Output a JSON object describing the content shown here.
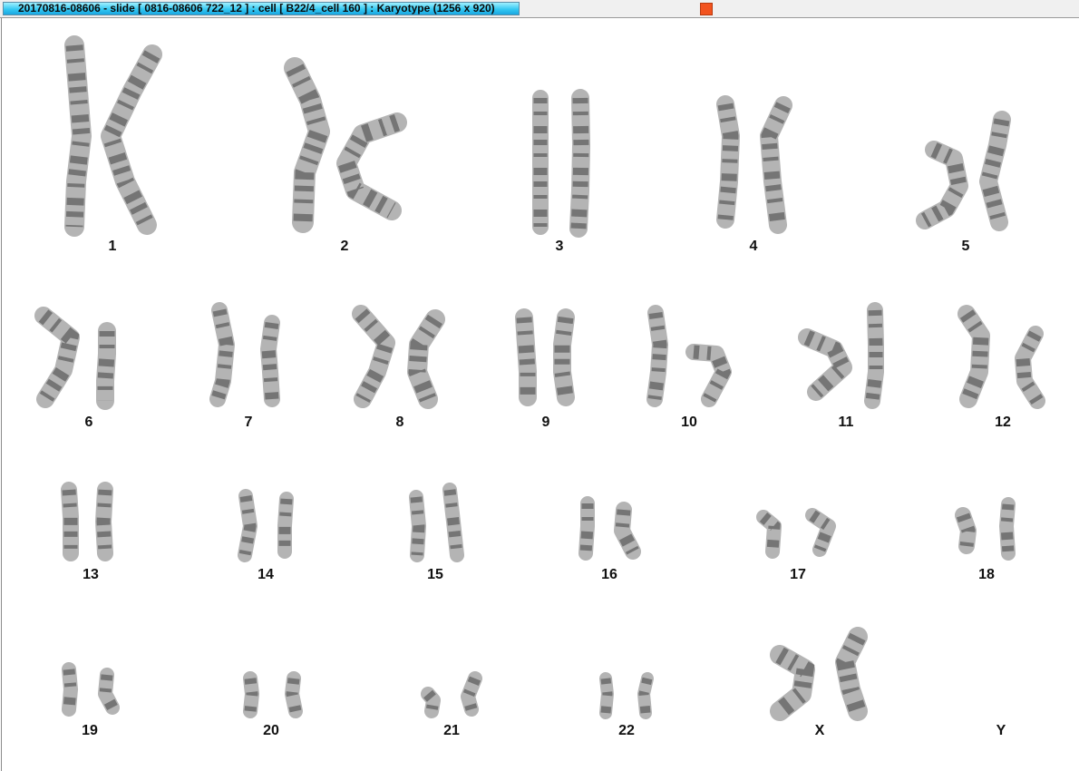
{
  "window": {
    "title": "20170816-08606 - slide [ 0816-08606 722_12 ] : cell [ B22/4_cell 160 ] : Karyotype  (1256 x 920)",
    "close_color": "#f2531f",
    "title_color": "#35c9f2"
  },
  "karyotype": {
    "labels": [
      "1",
      "2",
      "3",
      "4",
      "5",
      "6",
      "7",
      "8",
      "9",
      "10",
      "11",
      "12",
      "13",
      "14",
      "15",
      "16",
      "17",
      "18",
      "19",
      "20",
      "21",
      "22",
      "X",
      "Y"
    ]
  }
}
